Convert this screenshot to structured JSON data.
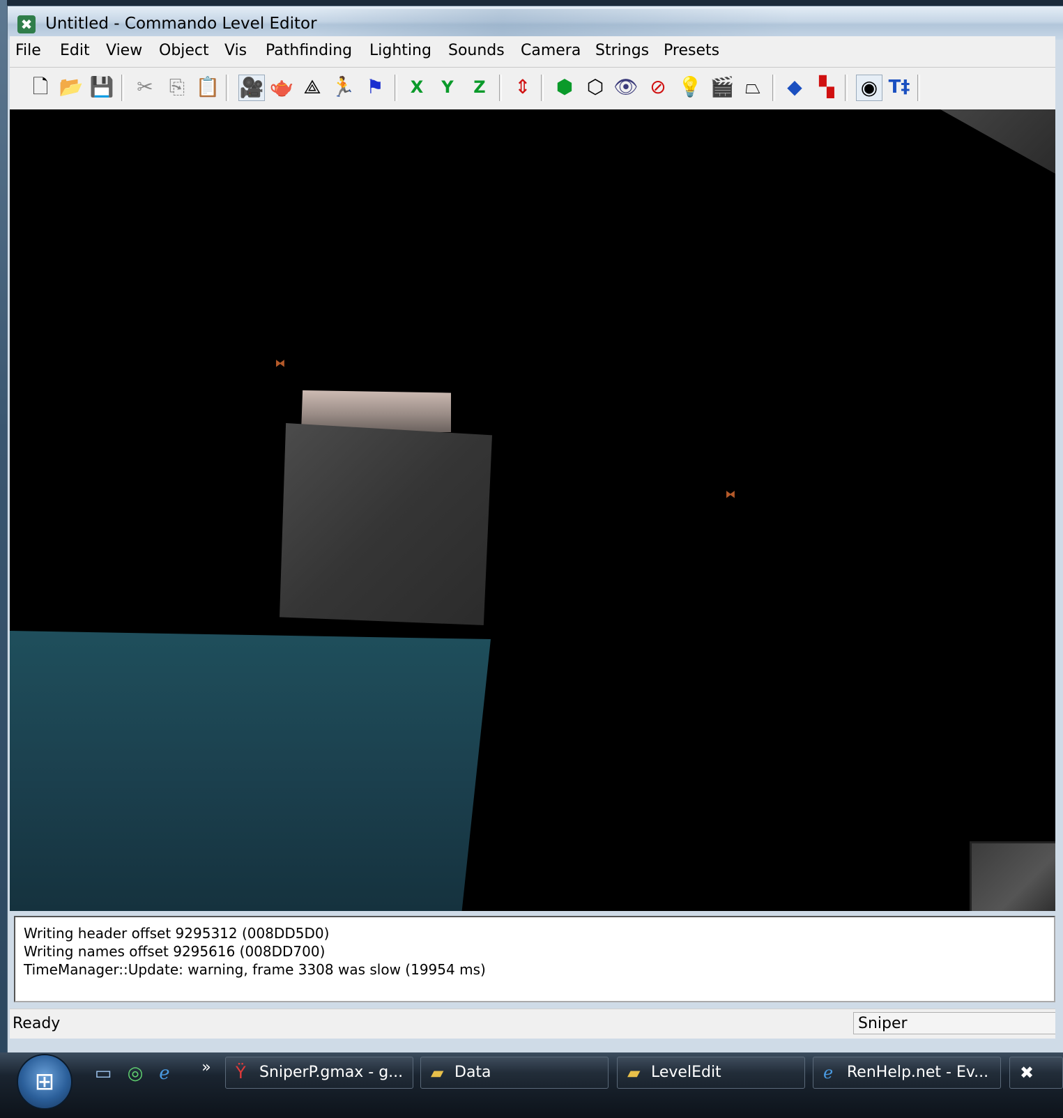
{
  "window": {
    "title": "Untitled - Commando Level Editor"
  },
  "menu": [
    "File",
    "Edit",
    "View",
    "Object",
    "Vis",
    "Pathfinding",
    "Lighting",
    "Sounds",
    "Camera",
    "Strings",
    "Presets"
  ],
  "toolbar": {
    "axis_x": "X",
    "axis_y": "Y",
    "axis_z": "Z",
    "text_tool": "T‡"
  },
  "output": {
    "lines": [
      "Writing header offset 9295312 (008DD5D0)",
      "Writing names offset 9295616 (008DD700)",
      "TimeManager::Update: warning, frame 3308 was slow (19954 ms)"
    ]
  },
  "status": {
    "text": "Ready",
    "panel": "Sniper"
  },
  "taskbar": {
    "overflow": "»",
    "items": [
      "SniperP.gmax - g...",
      "Data",
      "LevelEdit",
      "RenHelp.net - Ev..."
    ]
  }
}
